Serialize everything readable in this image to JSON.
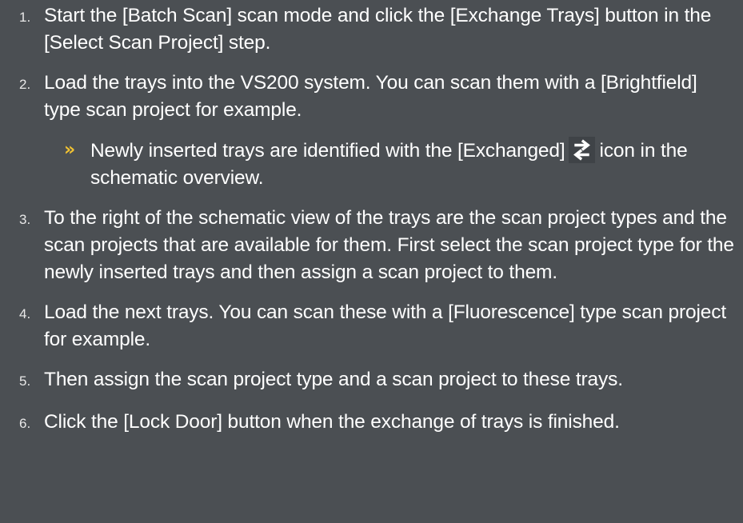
{
  "steps": [
    {
      "number": "1.",
      "text": "Start the [Batch Scan] scan mode and click the [Exchange Trays] button in the [Select Scan Project] step."
    },
    {
      "number": "2.",
      "text": "Load the trays into the VS200 system. You can scan them with a [Brightfield] type scan project for example."
    },
    {
      "number": "3.",
      "text": "To the right of the schematic view of the trays are the scan project types and the scan projects that are available for them. First select the scan project type for the newly inserted trays and then assign a scan project to them."
    },
    {
      "number": "4.",
      "text": "Load the next trays. You can scan these with a [Fluorescence] type scan project for example."
    },
    {
      "number": "5.",
      "text": "Then assign the scan project type and a scan project to these trays."
    },
    {
      "number": "6.",
      "text": "Click the [Lock Door] button when the exchange of trays is finished."
    }
  ],
  "result": {
    "marker": "»",
    "text_before_icon": "Newly inserted trays are identified with the [Exchanged]",
    "icon": "exchanged-icon",
    "text_after_icon": "icon in the schematic overview."
  },
  "colors": {
    "background": "#4b4f53",
    "text": "#ffffff",
    "result_marker": "#f1c232"
  }
}
